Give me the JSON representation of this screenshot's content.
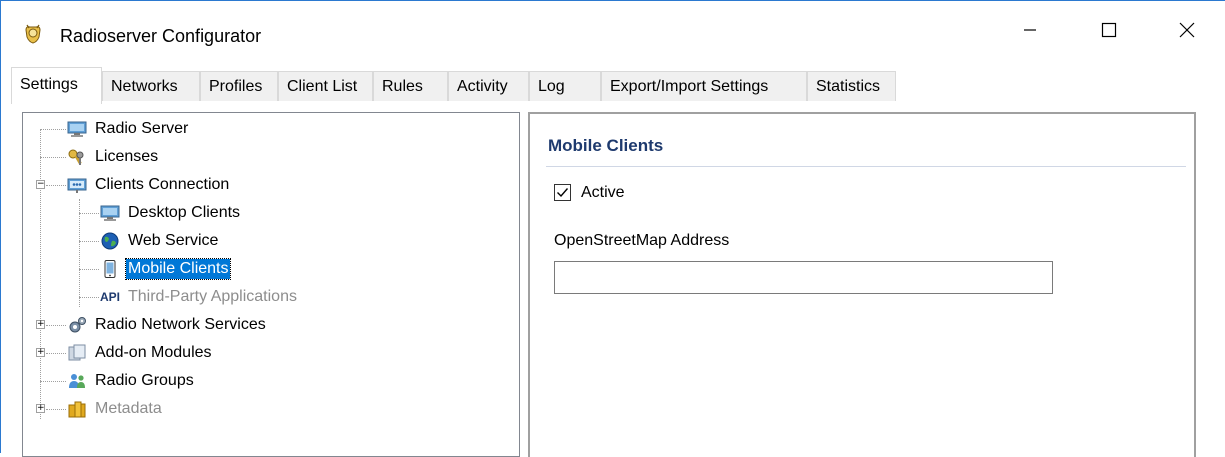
{
  "window": {
    "title": "Radioserver Configurator",
    "minimize_icon": "minimize-icon",
    "maximize_icon": "maximize-icon",
    "close_icon": "close-icon"
  },
  "tabs": [
    {
      "label": "Settings",
      "active": true
    },
    {
      "label": "Networks"
    },
    {
      "label": "Profiles"
    },
    {
      "label": "Client List"
    },
    {
      "label": "Rules"
    },
    {
      "label": "Activity"
    },
    {
      "label": "Log"
    },
    {
      "label": "Export/Import Settings"
    },
    {
      "label": "Statistics"
    }
  ],
  "tree": {
    "items": [
      {
        "label": "Radio Server",
        "icon": "monitor-icon"
      },
      {
        "label": "Licenses",
        "icon": "keys-icon"
      },
      {
        "label": "Clients Connection",
        "icon": "network-icon",
        "expanded": true
      },
      {
        "label": "Desktop Clients",
        "icon": "monitor-icon"
      },
      {
        "label": "Web Service",
        "icon": "globe-icon"
      },
      {
        "label": "Mobile Clients",
        "icon": "mobile-icon",
        "selected": true
      },
      {
        "label": "Third-Party Applications",
        "icon": "api-icon",
        "icon_text": "API",
        "disabled": true
      },
      {
        "label": "Radio Network Services",
        "icon": "gear-icon",
        "expanded": false
      },
      {
        "label": "Add-on Modules",
        "icon": "modules-icon",
        "expanded": false
      },
      {
        "label": "Radio Groups",
        "icon": "users-icon"
      },
      {
        "label": "Metadata",
        "icon": "database-icon",
        "expanded": false,
        "disabled": true
      }
    ]
  },
  "panel": {
    "title": "Mobile Clients",
    "active_label": "Active",
    "active_checked": true,
    "osm_label": "OpenStreetMap Address",
    "osm_value": ""
  },
  "colors": {
    "selection": "#0078d7",
    "section_title": "#1e3a6e",
    "border_accent": "#2b79d0"
  }
}
